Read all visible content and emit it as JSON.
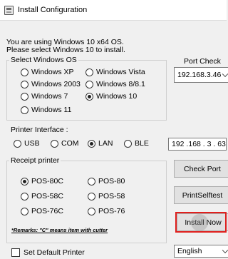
{
  "window": {
    "title": "Install Configuration",
    "icon": "installer-app-icon"
  },
  "intro": {
    "line1": "You are using Windows 10 x64 OS.",
    "line2": "Please select Windows 10 to install."
  },
  "os_group": {
    "legend": "Select Windows OS",
    "options": [
      {
        "label": "Windows XP",
        "selected": false
      },
      {
        "label": "Windows Vista",
        "selected": false
      },
      {
        "label": "Windows 2003",
        "selected": false
      },
      {
        "label": "Windows 8/8.1",
        "selected": false
      },
      {
        "label": "Windows 7",
        "selected": false
      },
      {
        "label": "Windows 10",
        "selected": true
      },
      {
        "label": "Windows 11",
        "selected": false
      }
    ]
  },
  "port_check": {
    "legend": "Port Check",
    "selected_ip": "192.168.3.46"
  },
  "interface": {
    "label": "Printer Interface :",
    "options": [
      {
        "label": "USB",
        "selected": false
      },
      {
        "label": "COM",
        "selected": false
      },
      {
        "label": "LAN",
        "selected": true
      },
      {
        "label": "BLE",
        "selected": false
      }
    ],
    "ip_value": "192 .168 . 3 . 63"
  },
  "receipt": {
    "legend": "Receipt printer",
    "options": [
      {
        "label": "POS-80C",
        "selected": true
      },
      {
        "label": "POS-80",
        "selected": false
      },
      {
        "label": "POS-58C",
        "selected": false
      },
      {
        "label": "POS-58",
        "selected": false
      },
      {
        "label": "POS-76C",
        "selected": false
      },
      {
        "label": "POS-76",
        "selected": false
      }
    ],
    "remarks": "*Remarks: \"C\" means item with cutter"
  },
  "buttons": {
    "check_port": "Check Port",
    "print_selftest": "PrintSelftest",
    "install_now": "Install Now"
  },
  "default_printer": {
    "label": "Set Default Printer",
    "checked": false
  },
  "language": {
    "selected": "English"
  },
  "colors": {
    "highlight": "#e0201e",
    "background": "#f0f0f0"
  }
}
